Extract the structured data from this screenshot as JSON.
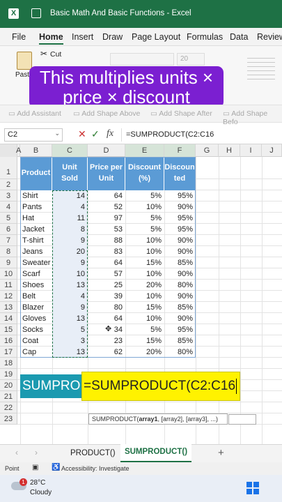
{
  "titlebar": {
    "title": "Basic Math And Basic Functions  -  Excel"
  },
  "menu": [
    "File",
    "Home",
    "Insert",
    "Draw",
    "Page Layout",
    "Formulas",
    "Data",
    "Review"
  ],
  "ribbon": {
    "cut": "Cut",
    "paste": "Paste",
    "font_size": "20"
  },
  "ribbon2": {
    "add_assistant": "Add Assistant",
    "add_shape_above": "Add Shape Above",
    "add_shape_after": "Add Shape After",
    "add_shape_before": "Add Shape Befo"
  },
  "overlay": {
    "line1": "This multiplies units ×",
    "line2": "price × discount"
  },
  "formulabar": {
    "namebox": "C2",
    "fx": "fx",
    "formula": "=SUMPRODUCT(C2:C16"
  },
  "columns": [
    "A",
    "B",
    "C",
    "D",
    "E",
    "F",
    "G",
    "H",
    "I",
    "J"
  ],
  "rows": [
    "1",
    "2",
    "3",
    "4",
    "5",
    "6",
    "7",
    "8",
    "9",
    "10",
    "11",
    "12",
    "13",
    "14",
    "15",
    "16",
    "17",
    "18",
    "19",
    "20",
    "21",
    "22",
    "23"
  ],
  "table": {
    "headers": [
      [
        "Product",
        ""
      ],
      [
        "Unit",
        "Sold"
      ],
      [
        "Price per",
        "Unit"
      ],
      [
        "Discount",
        "(%)"
      ],
      [
        "Discoun",
        "ted"
      ]
    ],
    "rows": [
      [
        "Shirt",
        "14",
        "64",
        "5%",
        "95%"
      ],
      [
        "Pants",
        "4",
        "52",
        "10%",
        "90%"
      ],
      [
        "Hat",
        "11",
        "97",
        "5%",
        "95%"
      ],
      [
        "Jacket",
        "8",
        "53",
        "5%",
        "95%"
      ],
      [
        "T-shirt",
        "9",
        "88",
        "10%",
        "90%"
      ],
      [
        "Jeans",
        "20",
        "83",
        "10%",
        "90%"
      ],
      [
        "Sweater",
        "9",
        "64",
        "15%",
        "85%"
      ],
      [
        "Scarf",
        "10",
        "57",
        "10%",
        "90%"
      ],
      [
        "Shoes",
        "13",
        "25",
        "20%",
        "80%"
      ],
      [
        "Belt",
        "4",
        "39",
        "10%",
        "90%"
      ],
      [
        "Blazer",
        "9",
        "80",
        "15%",
        "85%"
      ],
      [
        "Gloves",
        "13",
        "64",
        "10%",
        "90%"
      ],
      [
        "Socks",
        "5",
        "34",
        "5%",
        "95%"
      ],
      [
        "Coat",
        "3",
        "23",
        "15%",
        "85%"
      ],
      [
        "Cap",
        "13",
        "62",
        "20%",
        "80%"
      ]
    ]
  },
  "sumrow": {
    "label": "SUMPRO",
    "formula": "=SUMPRODUCT(C2:C16"
  },
  "tooltip": {
    "fn": "SUMPRODUCT(",
    "arg1": "array1",
    ",": ", [array2], [array3], ...)",
    "rest": ", [array2], [array3], ...)"
  },
  "sheets": {
    "tab1": "PRODUCT()",
    "tab2": "SUMPRODUCT()",
    "add": "+"
  },
  "status": {
    "mode": "Point",
    "accessibility": "Accessibility: Investigate"
  },
  "taskbar": {
    "temp": "28°C",
    "weather": "Cloudy",
    "badge": "1"
  }
}
